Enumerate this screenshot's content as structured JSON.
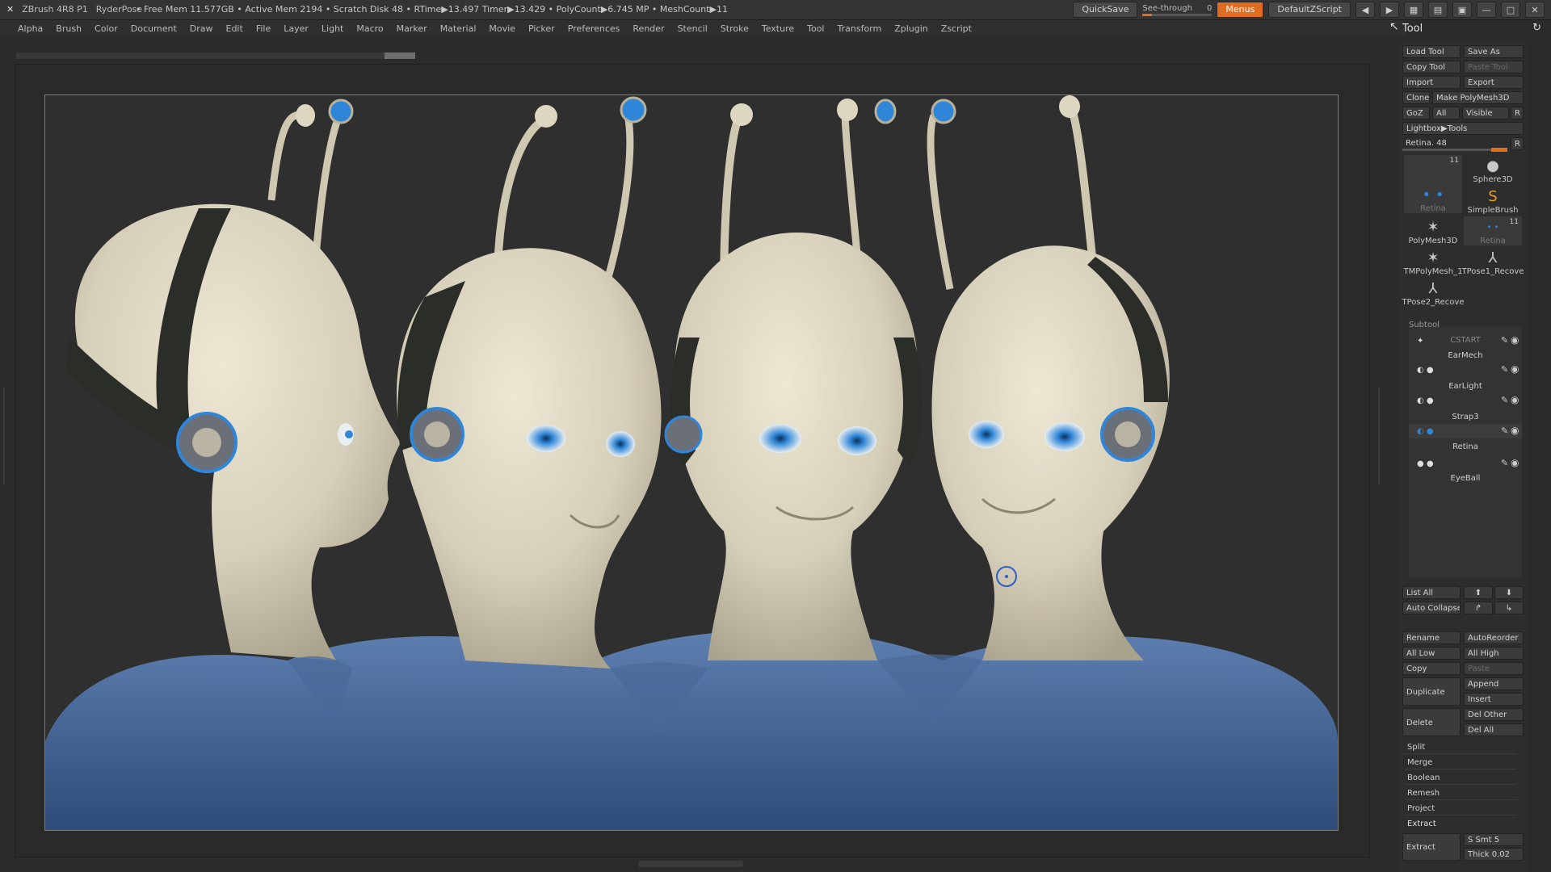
{
  "titlebar": {
    "app_name": "ZBrush 4R8 P1",
    "document": "RyderPose",
    "stats": "• Free Mem 11.577GB • Active Mem 2194 • Scratch Disk 48 • RTime▶13.497 Timer▶13.429 • PolyCount▶6.745 MP • MeshCount▶11",
    "quicksave": "QuickSave",
    "see_through_label": "See-through",
    "see_through_value": "0",
    "menus": "Menus",
    "default_zscript": "DefaultZScript"
  },
  "menu": [
    "Alpha",
    "Brush",
    "Color",
    "Document",
    "Draw",
    "Edit",
    "File",
    "Layer",
    "Light",
    "Macro",
    "Marker",
    "Material",
    "Movie",
    "Picker",
    "Preferences",
    "Render",
    "Stencil",
    "Stroke",
    "Texture",
    "Tool",
    "Transform",
    "Zplugin",
    "Zscript"
  ],
  "tool_panel": {
    "title": "Tool",
    "load_tool": "Load Tool",
    "save_as": "Save As",
    "copy_tool": "Copy Tool",
    "paste_tool": "Paste Tool",
    "import": "Import",
    "export": "Export",
    "clone": "Clone",
    "make_polymesh": "Make PolyMesh3D",
    "goz": "GoZ",
    "all": "All",
    "visible": "Visible",
    "r": "R",
    "lightbox_tools": "Lightbox▶Tools",
    "retina_label": "Retina. 48",
    "retina_r": "R",
    "thumbs": [
      {
        "label": "Retina",
        "count": "11"
      },
      {
        "label": "Sphere3D"
      },
      {
        "label": "SimpleBrush"
      },
      {
        "label": "PolyMesh3D"
      },
      {
        "label": "Retina",
        "count": "11"
      },
      {
        "label": "TMPolyMesh_1"
      },
      {
        "label": "TPose1_Recove"
      },
      {
        "label": "TPose2_Recove"
      }
    ],
    "subtool_header": "Subtool",
    "subtools": [
      "CSTART",
      "EarMech",
      "EarLight",
      "Strap3",
      "Retina",
      "EyeBall"
    ],
    "list_all": "List All",
    "auto_collapse": "Auto Collapse",
    "rename": "Rename",
    "autoreorder": "AutoReorder",
    "all_low": "All Low",
    "all_high": "All High",
    "copy": "Copy",
    "paste": "Paste",
    "duplicate": "Duplicate",
    "append": "Append",
    "insert": "Insert",
    "delete": "Delete",
    "del_other": "Del Other",
    "del_all": "Del All",
    "split": "Split",
    "merge": "Merge",
    "boolean": "Boolean",
    "remesh": "Remesh",
    "project": "Project",
    "extract_header": "Extract",
    "extract_btn": "Extract",
    "s_smt": "S Smt 5",
    "thick": "Thick 0.02"
  },
  "colors": {
    "accent": "#e06c20",
    "skin": "#d9d2bd",
    "shirt": "#3f5f8f",
    "eye": "#2f86d8",
    "strap": "#2b2d28"
  }
}
